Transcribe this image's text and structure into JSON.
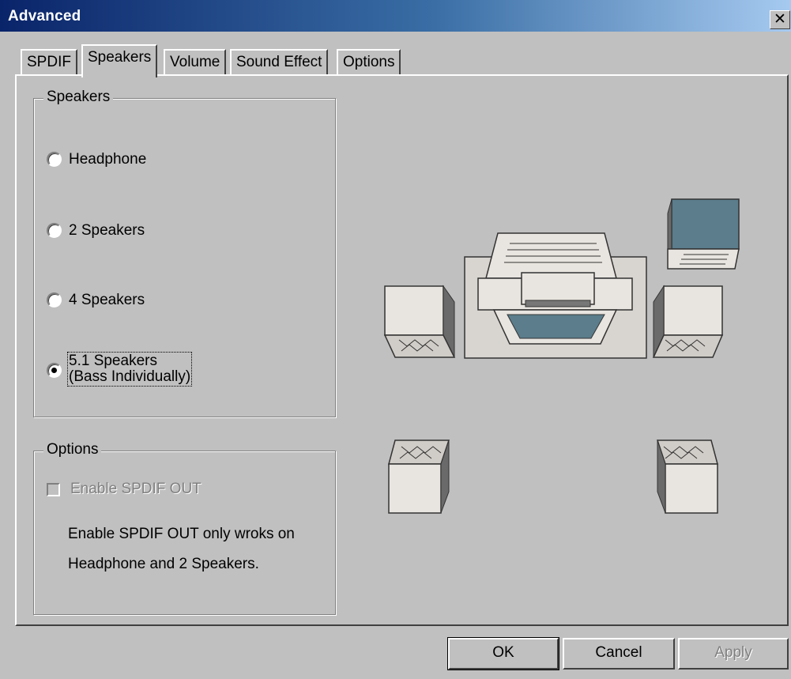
{
  "window": {
    "title": "Advanced",
    "close_glyph": "✕"
  },
  "tabs": [
    {
      "label": "SPDIF",
      "active": false
    },
    {
      "label": "Speakers",
      "active": true
    },
    {
      "label": "Volume",
      "active": false
    },
    {
      "label": "Sound Effect",
      "active": false
    },
    {
      "label": "Options",
      "active": false
    }
  ],
  "speakers_group": {
    "title": "Speakers",
    "options": [
      {
        "label": "Headphone",
        "checked": false
      },
      {
        "label": "2 Speakers",
        "checked": false
      },
      {
        "label": "4 Speakers",
        "checked": false
      },
      {
        "label_line1": "5.1 Speakers",
        "label_line2": "(Bass Individually)",
        "checked": true
      }
    ]
  },
  "options_group": {
    "title": "Options",
    "checkbox_label": "Enable SPDIF OUT",
    "checkbox_checked": false,
    "checkbox_enabled": false,
    "note_line1": "Enable SPDIF OUT only wroks on",
    "note_line2": "Headphone and 2 Speakers."
  },
  "illustration": {
    "icon": "speaker-layout-5-1-icon"
  },
  "buttons": {
    "ok": "OK",
    "cancel": "Cancel",
    "apply": "Apply"
  },
  "colors": {
    "face": "#c0c0c0",
    "title_start": "#0a246a",
    "title_end": "#a6caf0",
    "disabled": "#808080",
    "speaker_face": "#e8e4df",
    "monitor_screen": "#5b7d8c"
  }
}
